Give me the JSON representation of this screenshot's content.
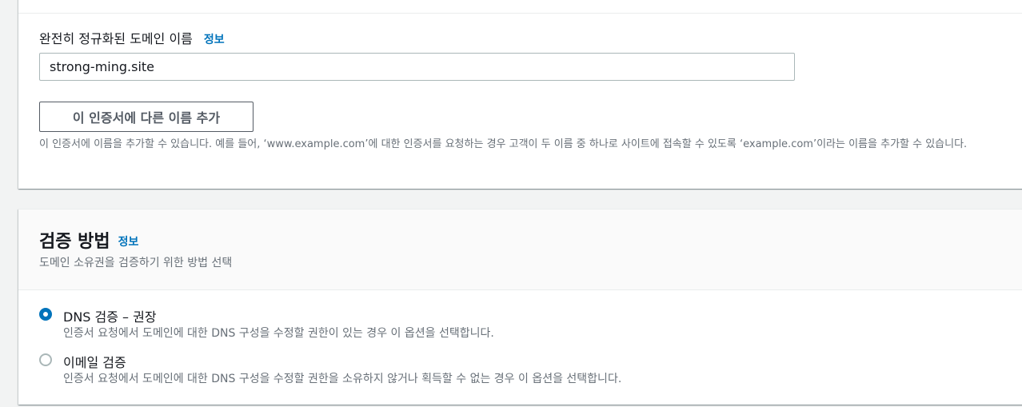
{
  "domain_section": {
    "label": "완전히 정규화된 도메인 이름",
    "info_link": "정보",
    "input_value": "strong-ming.site",
    "add_button": "이 인증서에 다른 이름 추가",
    "description": "이 인증서에 이름을 추가할 수 있습니다. 예를 들어, ‘www.example.com’에 대한 인증서를 요청하는 경우 고객이 두 이름 중 하나로 사이트에 접속할 수 있도록 ‘example.com’이라는 이름을 추가할 수 있습니다."
  },
  "validation_section": {
    "title": "검증 방법",
    "info_link": "정보",
    "subtitle": "도메인 소유권을 검증하기 위한 방법 선택",
    "options": [
      {
        "label": "DNS 검증 – 권장",
        "description": "인증서 요청에서 도메인에 대한 DNS 구성을 수정할 권한이 있는 경우 이 옵션을 선택합니다.",
        "selected": true
      },
      {
        "label": "이메일 검증",
        "description": "인증서 요청에서 도메인에 대한 DNS 구성을 수정할 권한을 소유하지 않거나 획득할 수 없는 경우 이 옵션을 선택합니다.",
        "selected": false
      }
    ]
  },
  "colors": {
    "accent": "#0073bb",
    "text": "#16191f",
    "muted": "#687078",
    "background": "#f2f3f3"
  }
}
